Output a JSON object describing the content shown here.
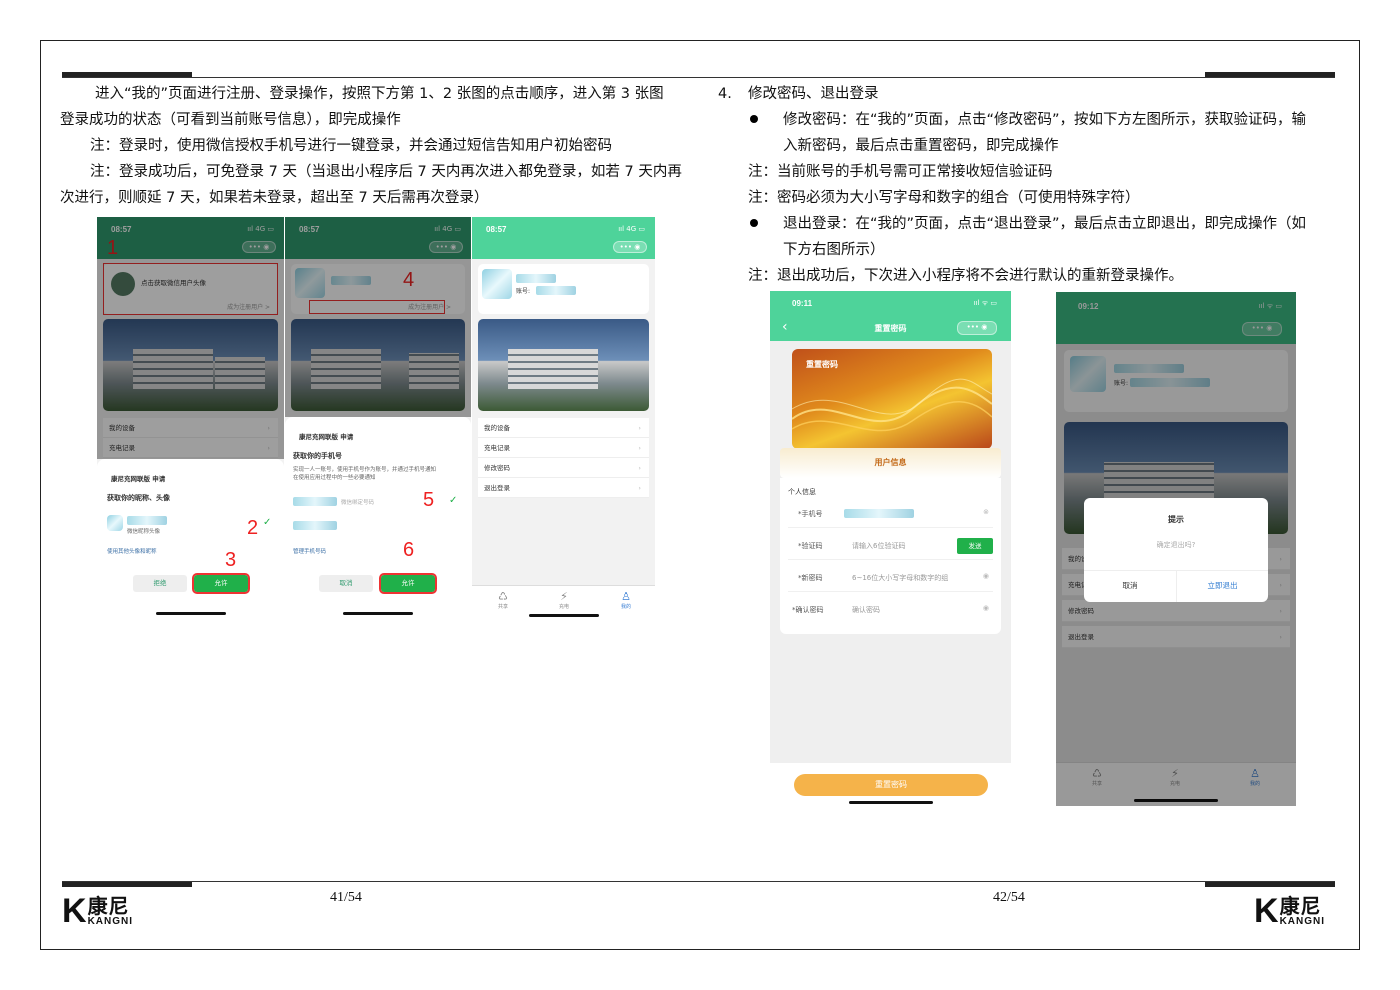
{
  "left_page": {
    "para1_line1": "进入“我的”页面进行注册、登录操作，按照下方第 1、2 张图的点击顺序，进入第 3 张图",
    "para1_line2": "登录成功的状态（可看到当前账号信息），即完成操作",
    "note1": "注：登录时，使用微信授权手机号进行一键登录，并会通过短信告知用户初始密码",
    "note2_line1": "注：登录成功后，可免登录 7 天（当退出小程序后 7 天内再次进入都免登录，如若 7 天内再",
    "note2_line2": "次进行，则顺延 7 天，如果若未登录，超出至 7 天后需再次登录）",
    "page_number": "41/54"
  },
  "right_page": {
    "section_num": "4.",
    "section_title": "修改密码、退出登录",
    "bullet1_line1": "修改密码：在“我的”页面，点击“修改密码”，按如下方左图所示，获取验证码，输",
    "bullet1_line2": "入新密码，最后点击重置密码，即完成操作",
    "note1": "注：当前账号的手机号需可正常接收短信验证码",
    "note2": "注：密码必须为大小写字母和数字的组合（可使用特殊字符）",
    "bullet2_line1": "退出登录：在“我的”页面，点击“退出登录”，最后点击立即退出，即完成操作（如",
    "bullet2_line2": "下方右图所示）",
    "note3": "注：退出成功后，下次进入小程序将不会进行默认的重新登录操作。",
    "page_number": "42/54"
  },
  "logo": {
    "cn": "康尼",
    "en": "KANGNI",
    "mark": "K"
  },
  "phone1": {
    "time": "08:57",
    "signal": "ııl 4G ▭",
    "avatar_prompt": "点击获取微信用户头像",
    "register_link": "成为注册用户 >",
    "menu": [
      "我的设备",
      "充电记录"
    ],
    "sheet_app": "康尼充网联版 申请",
    "sheet_title": "获取你的昵称、头像",
    "sheet_option": "微信昵称头像",
    "sheet_other": "使用其他头像和昵称",
    "reject": "拒绝",
    "allow": "允许",
    "marks": [
      "1",
      "2",
      "3"
    ]
  },
  "phone2": {
    "time": "08:57",
    "signal": "ııl 4G ▭",
    "register_link": "成为注册用户 >",
    "sheet_app": "康尼充网联版 申请",
    "sheet_title": "获取你的手机号",
    "sheet_desc1": "实现一人一账号，使用手机号作为账号，并通过手机号通知",
    "sheet_desc2": "在使用应用过程中的一些必要通知",
    "sheet_phone_hint": "微信绑定号码",
    "manage": "管理手机号码",
    "cancel": "取消",
    "allow": "允许",
    "marks": [
      "4",
      "5",
      "6"
    ]
  },
  "phone3": {
    "time": "08:57",
    "signal": "ııl 4G ▭",
    "account_label": "账号:",
    "menu": [
      "我的设备",
      "充电记录",
      "修改密码",
      "退出登录"
    ],
    "tabs": [
      "共享",
      "充电",
      "我的"
    ]
  },
  "phone4": {
    "time": "09:11",
    "signal": "ııl ᯤ ▭",
    "back": "‹",
    "title": "重置密码",
    "banner_title": "重置密码",
    "user_info": "用户信息",
    "section": "个人信息",
    "fields": [
      {
        "label": "*手机号",
        "value": ""
      },
      {
        "label": "*验证码",
        "value": "请输入6位验证码"
      },
      {
        "label": "*新密码",
        "value": "6~16位大小写字母和数字的组"
      },
      {
        "label": "*确认密码",
        "value": "确认密码"
      }
    ],
    "send": "发送",
    "submit": "重置密码"
  },
  "phone5": {
    "time": "09:12",
    "signal": "ııl ᯤ ▭",
    "account_label": "账号:",
    "menu": [
      "我的设备",
      "充电记录",
      "修改密码",
      "退出登录"
    ],
    "dialog_title": "提示",
    "dialog_msg": "确定退出吗?",
    "dialog_cancel": "取消",
    "dialog_confirm": "立即退出",
    "tabs": [
      "共享",
      "充电",
      "我的"
    ]
  }
}
